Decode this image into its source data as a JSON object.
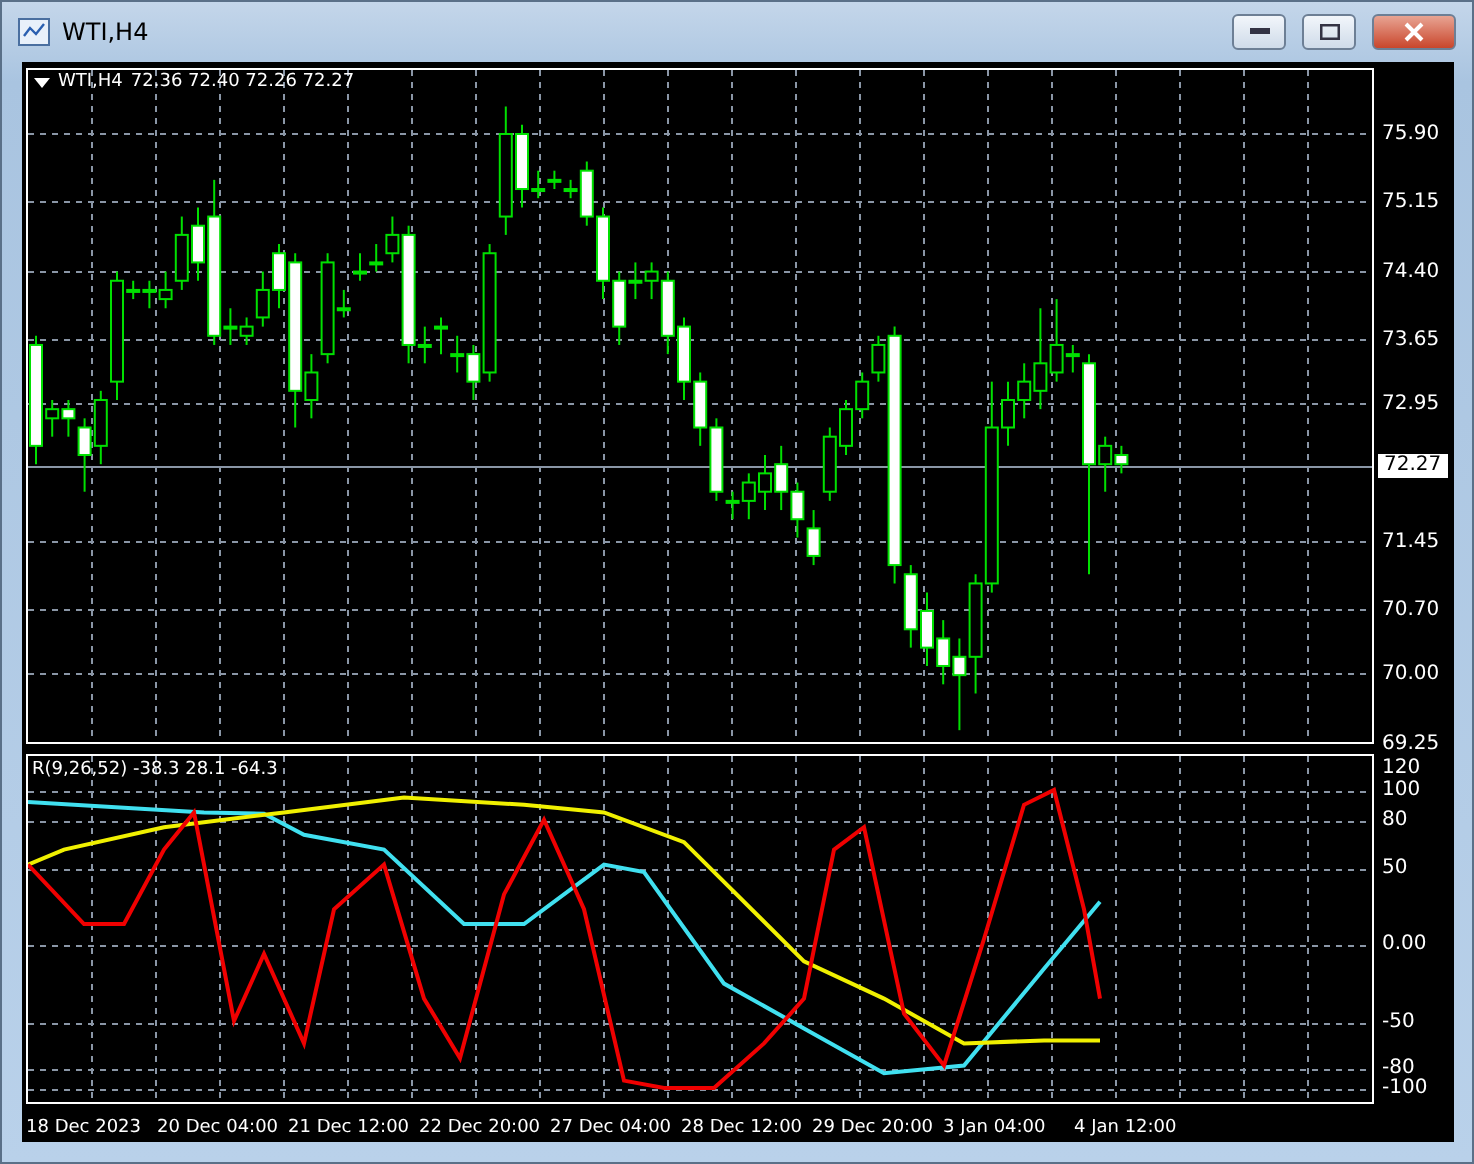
{
  "window": {
    "title": "WTI,H4"
  },
  "legend": {
    "symbol": "WTI,H4",
    "values": "72.36 72.40 72.26 72.27"
  },
  "price_axis": [
    "75.90",
    "75.15",
    "74.40",
    "73.65",
    "72.95",
    "71.45",
    "70.70",
    "70.00",
    "69.25"
  ],
  "current_price": "72.27",
  "indicator": {
    "label": "R(9,26,52) -38.3 28.1 -64.3",
    "axis": [
      "120",
      "100",
      "80",
      "50",
      "0.00",
      "-50",
      "-80",
      "-100"
    ]
  },
  "time_axis": [
    "18 Dec 2023",
    "20 Dec 04:00",
    "21 Dec 12:00",
    "22 Dec 20:00",
    "27 Dec 04:00",
    "28 Dec 12:00",
    "29 Dec 20:00",
    "3 Jan 04:00",
    "4 Jan 12:00"
  ]
}
